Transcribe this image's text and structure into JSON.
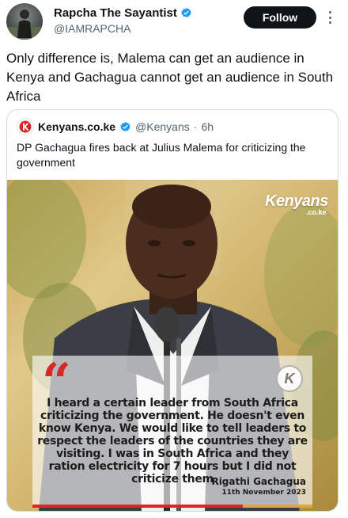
{
  "author": {
    "display_name": "Rapcha The Sayantist",
    "handle": "@IAMRAPCHA",
    "verified_icon": "verified-badge-icon"
  },
  "actions": {
    "follow_label": "Follow",
    "more_icon": "more-options-icon"
  },
  "tweet": {
    "text": "Only difference is, Malema can get an audience in Kenya and Gachagua cannot get an audience in South Africa"
  },
  "quoted": {
    "name": "Kenyans.co.ke",
    "handle": "@Kenyans",
    "separator": "·",
    "time": "6h",
    "text": "DP Gachagua fires back at Julius Malema for criticizing the government",
    "image": {
      "brand": "Kenyans",
      "brand_sub": ".co.ke",
      "quote_mark": "“",
      "badge_letter": "K",
      "quote": "I heard a certain leader from South Africa criticizing the government. He doesn't even know Kenya. We would like to tell leaders to respect the leaders of the countries they are visiting. I was in South Africa and they ration electricity for 7 hours but I did not criticize them",
      "speaker": "Rigathi Gachagua",
      "date": "11th November 2023"
    }
  },
  "colors": {
    "verified_blue": "#1d9bf0",
    "quote_red": "#d62828",
    "accent_gold": "#e0a43a"
  }
}
